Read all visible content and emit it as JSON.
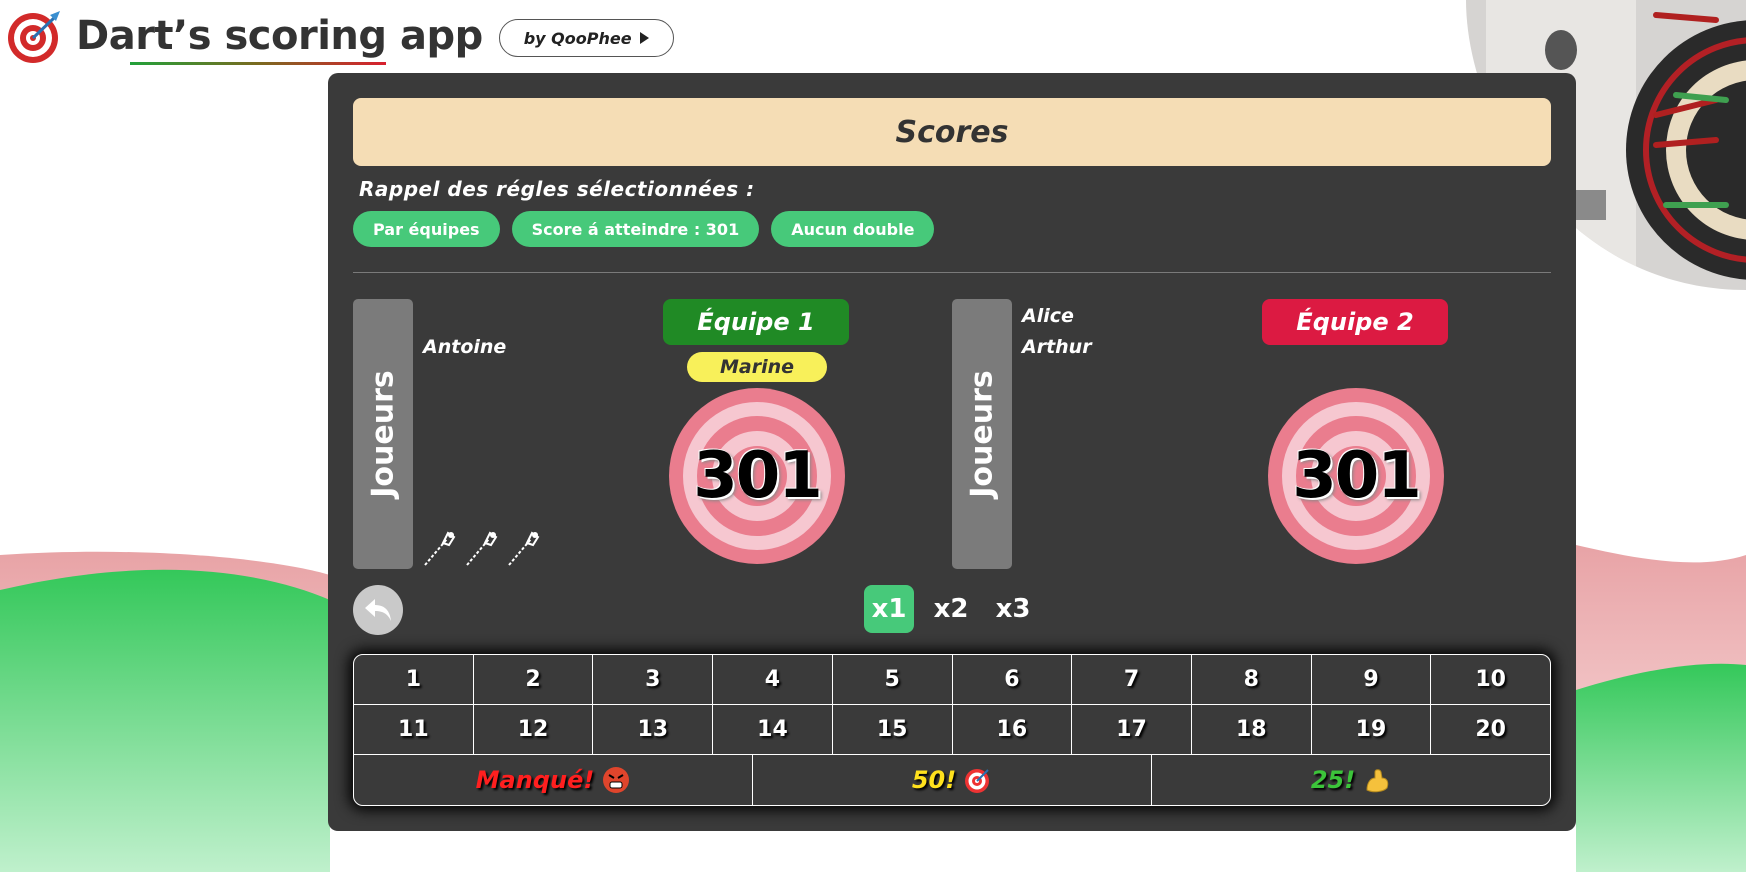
{
  "header": {
    "title": "Dart’s scoring app",
    "by_label": "by QooPhee"
  },
  "scores": {
    "title": "Scores"
  },
  "rules": {
    "title": "Rappel des régles sélectionnées :",
    "chips": [
      "Par équipes",
      "Score á atteindre : 301",
      "Aucun double"
    ]
  },
  "teams": [
    {
      "tab_label": "Joueurs",
      "players": [
        "",
        "Antoine"
      ],
      "name": "Équipe 1",
      "current_player": "Marine",
      "score": "301",
      "color": "#208a25"
    },
    {
      "tab_label": "Joueurs",
      "players": [
        "Alice",
        "Arthur"
      ],
      "name": "Équipe 2",
      "score": "301",
      "color": "#dc1a42"
    }
  ],
  "darts_remaining": 3,
  "multipliers": [
    "x1",
    "x2",
    "x3"
  ],
  "active_multiplier": "x1",
  "numbers_row1": [
    "1",
    "2",
    "3",
    "4",
    "5",
    "6",
    "7",
    "8",
    "9",
    "10"
  ],
  "numbers_row2": [
    "11",
    "12",
    "13",
    "14",
    "15",
    "16",
    "17",
    "18",
    "19",
    "20"
  ],
  "specials": {
    "missed": "Manqué!",
    "bull": "50!",
    "half_bull": "25!"
  },
  "icons": {
    "logo": "dartboard-icon",
    "undo": "undo-arrow-icon",
    "dart": "dart-icon",
    "missed": "angry-face-icon",
    "bull": "bullseye-icon",
    "half_bull": "flexed-arm-icon"
  }
}
